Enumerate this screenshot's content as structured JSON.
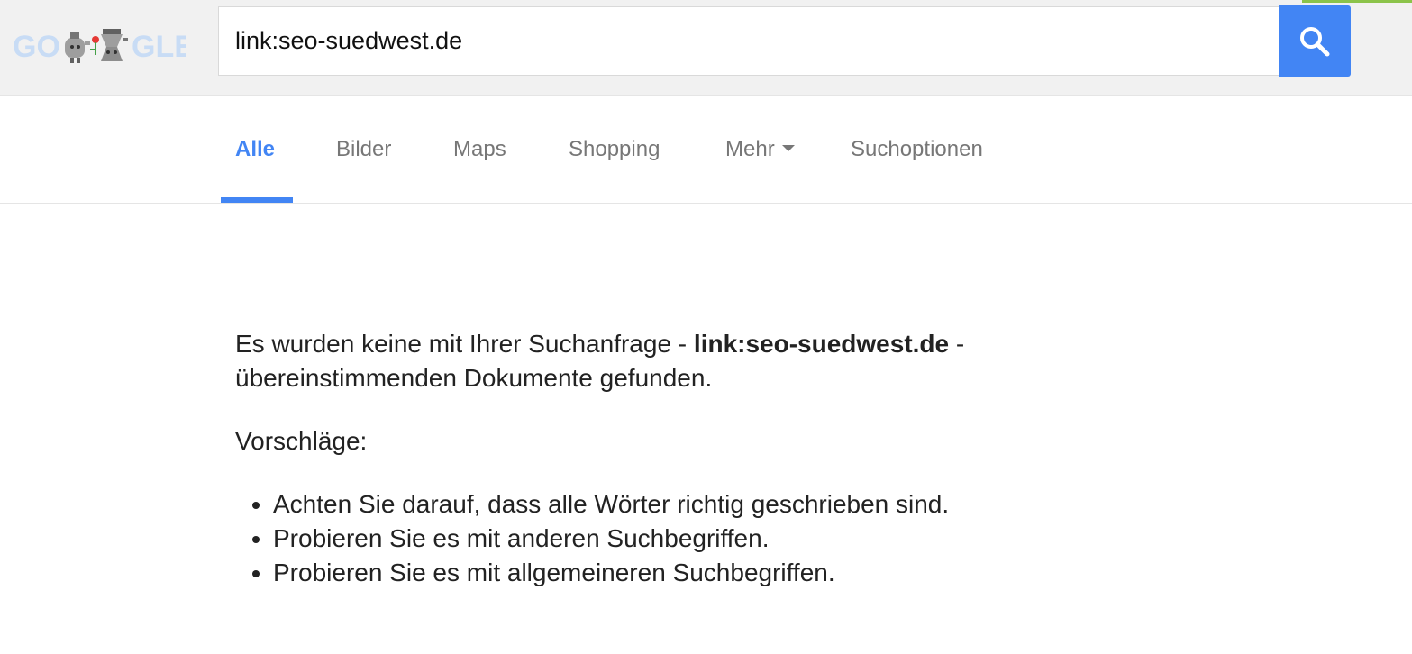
{
  "logo": {
    "alt": "Google Doodle",
    "letters_left": "GO",
    "letters_right": "GLE"
  },
  "search": {
    "query": "link:seo-suedwest.de",
    "button_icon": "search-icon"
  },
  "tabs": [
    {
      "label": "Alle",
      "active": true
    },
    {
      "label": "Bilder",
      "active": false
    },
    {
      "label": "Maps",
      "active": false
    },
    {
      "label": "Shopping",
      "active": false
    },
    {
      "label": "Mehr",
      "active": false,
      "icon": "caret-down-icon"
    },
    {
      "label": "Suchoptionen",
      "active": false
    }
  ],
  "no_results": {
    "prefix": "Es wurden keine mit Ihrer Suchanfrage - ",
    "query": "link:seo-suedwest.de",
    "suffix": " - übereinstimmenden Dokumente gefunden.",
    "suggestions_title": "Vorschläge:",
    "suggestions": [
      "Achten Sie darauf, dass alle Wörter richtig geschrieben sind.",
      "Probieren Sie es mit anderen Suchbegriffen.",
      "Probieren Sie es mit allgemeineren Suchbegriffen."
    ]
  },
  "colors": {
    "accent": "#4285f4",
    "topbar_bg": "#f1f1f1",
    "tab_inactive": "#777777"
  }
}
